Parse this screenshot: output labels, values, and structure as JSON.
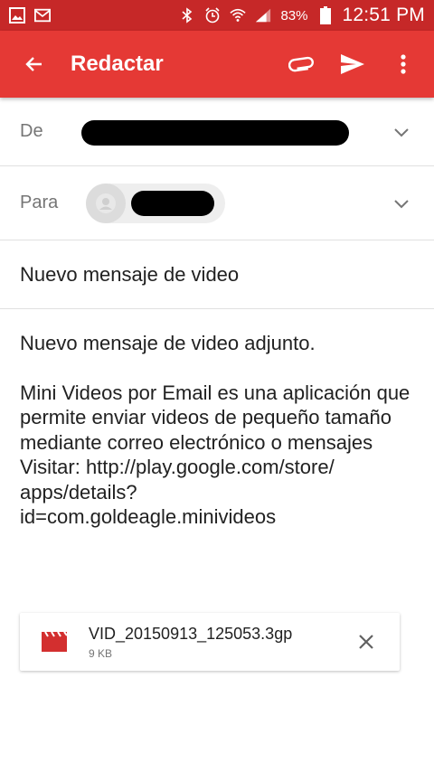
{
  "status_bar": {
    "left_icons": [
      "image-icon",
      "gmail-icon"
    ],
    "right_icons": [
      "bluetooth-icon",
      "alarm-icon",
      "wifi-icon",
      "signal-icon",
      "battery-icon"
    ],
    "battery_percent": "83%",
    "time": "12:51 PM",
    "color": "#c62828"
  },
  "app_bar": {
    "title": "Redactar",
    "color": "#e53935",
    "actions": [
      "attach-icon",
      "send-icon",
      "more-icon"
    ]
  },
  "compose": {
    "from_label": "De",
    "to_label": "Para",
    "subject": "Nuevo mensaje de video",
    "body_intro": "Nuevo mensaje de video adjunto.",
    "body_message": "Mini Videos por Email es una aplicación que permite enviar videos de pequeño tamaño mediante correo electrónico o mensajes",
    "body_visit_1": "Visitar: http://play.google.com/store/",
    "body_visit_2": "apps/details?",
    "body_visit_3": "id=com.goldeagle.minivideos"
  },
  "attachment": {
    "name": "VID_20150913_125053.3gp",
    "size": "9 KB",
    "icon": "video-file-icon",
    "icon_color": "#d32f2f"
  }
}
